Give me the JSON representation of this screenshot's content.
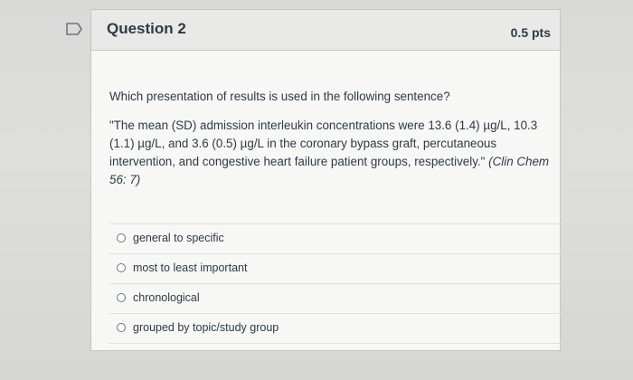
{
  "question": {
    "title": "Question 2",
    "points": "0.5 pts",
    "prompt": "Which presentation of results is used in the following sentence?",
    "quote": "\"The mean (SD) admission interleukin concentrations were 13.6 (1.4) µg/L, 10.3 (1.1) µg/L, and 3.6 (0.5) µg/L in the coronary bypass graft, percutaneous intervention, and congestive heart failure patient groups, respectively.\"",
    "source": "(Clin Chem 56: 7)"
  },
  "answers": [
    {
      "label": "general to specific"
    },
    {
      "label": "most to least important"
    },
    {
      "label": "chronological"
    },
    {
      "label": "grouped by topic/study group"
    }
  ],
  "icons": {
    "flag": "flag-icon"
  },
  "colors": {
    "text": "#2d3b45",
    "header_bg": "#e9e9e7",
    "card_bg": "#f7f7f5"
  }
}
